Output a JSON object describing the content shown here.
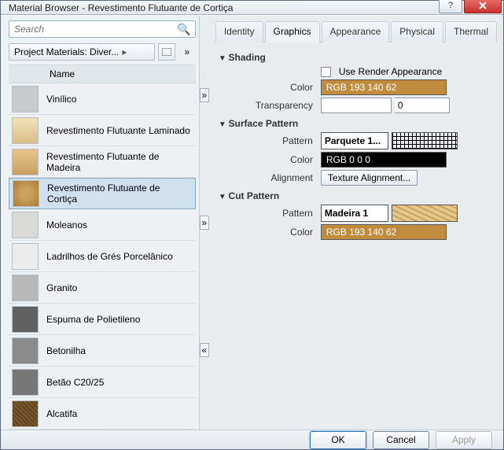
{
  "window": {
    "title": "Material Browser - Revestimento Flutuante de Cortiça"
  },
  "left": {
    "search_placeholder": "Search",
    "project_dropdown": "Project Materials: Diver...",
    "name_header": "Name",
    "expand_right": "»",
    "materials": [
      {
        "label": "Vinílico",
        "thumb_class": "t-vin",
        "selected": false
      },
      {
        "label": "Revestimento Flutuante Laminado",
        "thumb_class": "t-lam",
        "selected": false
      },
      {
        "label": "Revestimento Flutuante de Madeira",
        "thumb_class": "t-wood",
        "selected": false
      },
      {
        "label": "Revestimento Flutuante de Cortiça",
        "thumb_class": "t-cork",
        "selected": true
      },
      {
        "label": "Moleanos",
        "thumb_class": "t-mol",
        "selected": false
      },
      {
        "label": "Ladrilhos de Grés Porcelânico",
        "thumb_class": "t-por",
        "selected": false
      },
      {
        "label": "Granito",
        "thumb_class": "t-gra",
        "selected": false
      },
      {
        "label": "Espuma de Polietileno",
        "thumb_class": "t-esp",
        "selected": false
      },
      {
        "label": "Betonilha",
        "thumb_class": "t-bet",
        "selected": false
      },
      {
        "label": "Betão C20/25",
        "thumb_class": "t-c20",
        "selected": false
      },
      {
        "label": "Alcatifa",
        "thumb_class": "t-alc",
        "selected": false
      }
    ]
  },
  "tabs": {
    "identity": "Identity",
    "graphics": "Graphics",
    "appearance": "Appearance",
    "physical": "Physical",
    "thermal": "Thermal",
    "active": "graphics"
  },
  "graphics": {
    "shading": {
      "title": "Shading",
      "use_render_label": "Use Render Appearance",
      "use_render_checked": false,
      "color_label": "Color",
      "color_text": "RGB 193 140 62",
      "color_hex": "#c18c3e",
      "transparency_label": "Transparency",
      "transparency_value": "0"
    },
    "surface": {
      "title": "Surface Pattern",
      "pattern_label": "Pattern",
      "pattern_name": "Parquete 1...",
      "color_label": "Color",
      "color_text": "RGB 0 0 0",
      "color_hex": "#000000",
      "alignment_label": "Alignment",
      "alignment_button": "Texture Alignment..."
    },
    "cut": {
      "title": "Cut Pattern",
      "pattern_label": "Pattern",
      "pattern_name": "Madeira 1",
      "color_label": "Color",
      "color_text": "RGB 193 140 62",
      "color_hex": "#c18c3e"
    }
  },
  "buttons": {
    "ok": "OK",
    "cancel": "Cancel",
    "apply": "Apply"
  },
  "expander": {
    "collapse": "«",
    "expand": "»"
  }
}
